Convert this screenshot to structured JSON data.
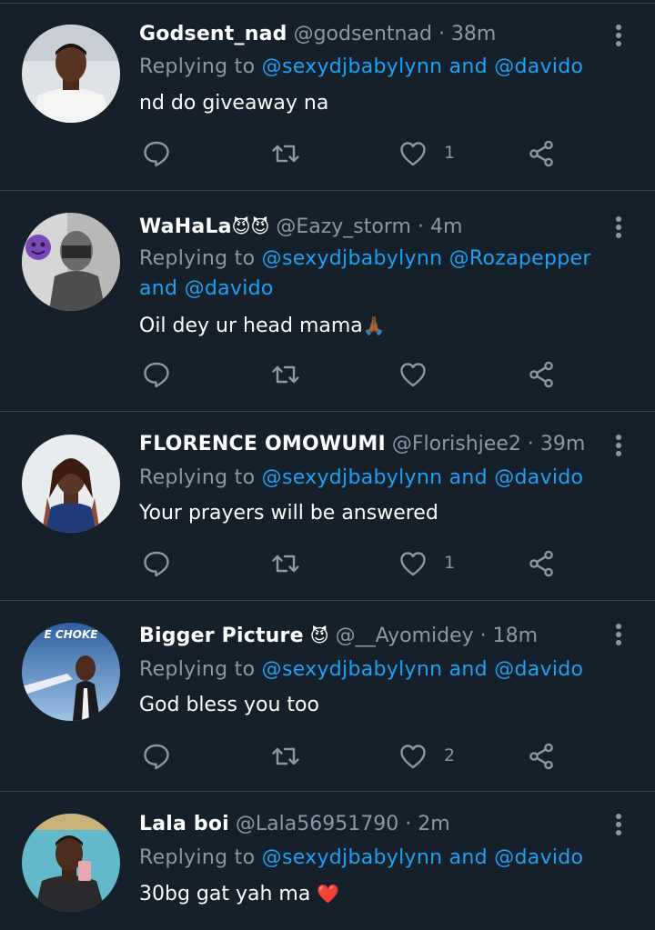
{
  "colors": {
    "background": "#15202b",
    "divider": "#38444d",
    "secondary_text": "#8899a6",
    "mention": "#1da1f2",
    "primary_text": "#ffffff"
  },
  "icons": {
    "reply": "reply-icon",
    "retweet": "retweet-icon",
    "like": "heart-icon",
    "share": "share-icon",
    "more": "more-vertical-icon"
  },
  "tweets": [
    {
      "display_name": "Godsent_nad",
      "handle": "@godsentnad",
      "separator": "·",
      "time": "38m",
      "replying_prefix": "Replying to",
      "mention_1": "@sexydjbabylynn",
      "joiner": "and",
      "mention_2": "@davido",
      "text": "nd do giveaway na",
      "like_count": "1"
    },
    {
      "display_name": "WaHaLa",
      "name_emoji": "😈😈",
      "handle": "@Eazy_storm",
      "separator": "·",
      "time": "4m",
      "replying_prefix": "Replying to",
      "mention_1": "@sexydjbabylynn",
      "mention_2": "@Rozapepper",
      "joiner": "and",
      "mention_3": "@davido",
      "text": "Oil dey ur head mama",
      "text_emoji": "🙏🏾",
      "like_count": ""
    },
    {
      "display_name": "FLORENCE OMOWUMI",
      "handle": "@Florishjee2",
      "separator": "·",
      "time": "39m",
      "replying_prefix": "Replying to",
      "mention_1": "@sexydjbabylynn",
      "joiner": "and",
      "mention_2": "@davido",
      "text": "Your prayers will be answered",
      "like_count": "1"
    },
    {
      "display_name": "Bigger Picture",
      "name_emoji": "😈",
      "handle": "@__Ayomidey",
      "separator": "·",
      "time": "18m",
      "avatar_caption": "E CHOKE",
      "replying_prefix": "Replying to",
      "mention_1": "@sexydjbabylynn",
      "joiner": "and",
      "mention_2": "@davido",
      "text": "God bless you too",
      "like_count": "2"
    },
    {
      "display_name": "Lala boi",
      "handle": "@Lala56951790",
      "separator": "·",
      "time": "2m",
      "replying_prefix": "Replying to",
      "mention_1": "@sexydjbabylynn",
      "joiner": "and",
      "mention_2": "@davido",
      "text": "30bg gat yah ma",
      "text_emoji": "❤️"
    }
  ]
}
